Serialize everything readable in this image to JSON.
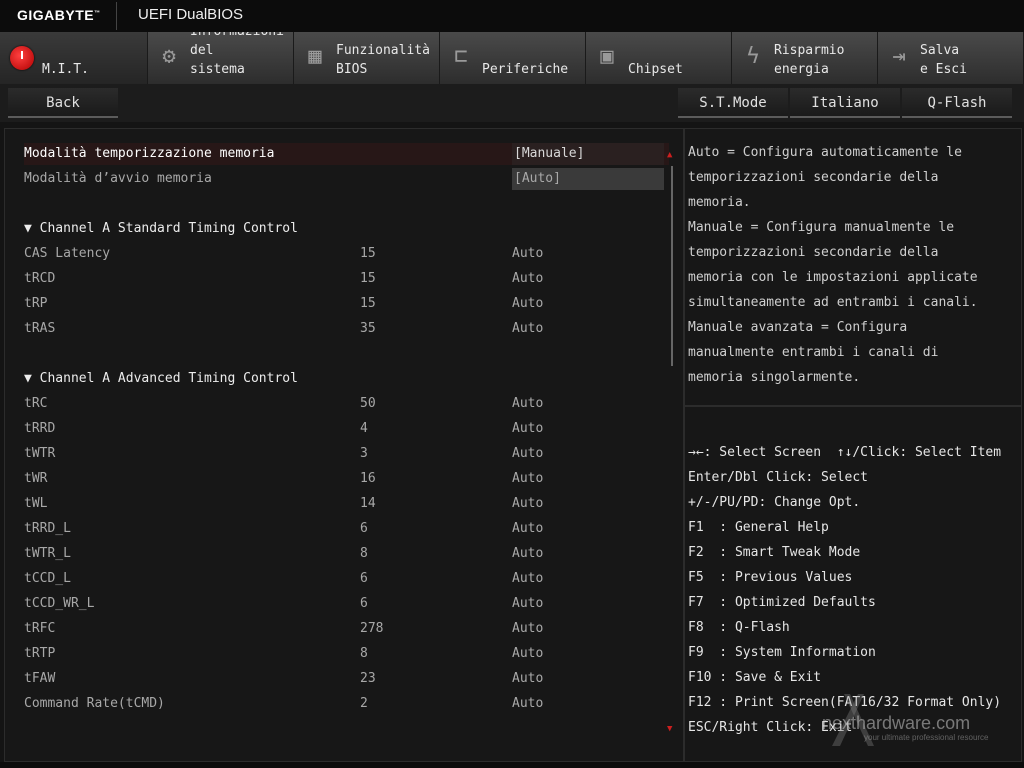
{
  "header": {
    "logo": "GIGABYTE",
    "logo_mark": "™",
    "title": "UEFI DualBIOS"
  },
  "tabs": [
    {
      "label": "M.I.T.",
      "icon": "power-dial-icon"
    },
    {
      "label": "Informazioni\ndel\nsistema",
      "icon": "gear-icon"
    },
    {
      "label": "Funzionalità\nBIOS",
      "icon": "chip-plus-icon"
    },
    {
      "label": "Periferiche",
      "icon": "plug-icon"
    },
    {
      "label": "Chipset",
      "icon": "chip-icon"
    },
    {
      "label": "Risparmio\nenergia",
      "icon": "lightning-icon"
    },
    {
      "label": "Salva\ne Esci",
      "icon": "exit-icon"
    }
  ],
  "buttons": {
    "back": "Back",
    "st_mode": "S.T.Mode",
    "language": "Italiano",
    "qflash": "Q-Flash"
  },
  "settings": {
    "timing_mode": {
      "label": "Modalità temporizzazione memoria",
      "value": "[Manuale]"
    },
    "boot_mode": {
      "label": "Modalità d’avvio memoria",
      "value": "[Auto]"
    }
  },
  "channel_a_standard": {
    "title": "▼ Channel A Standard Timing Control",
    "rows": [
      {
        "name": "CAS Latency",
        "value": "15",
        "mode": "Auto"
      },
      {
        "name": "tRCD",
        "value": "15",
        "mode": "Auto"
      },
      {
        "name": "tRP",
        "value": "15",
        "mode": "Auto"
      },
      {
        "name": "tRAS",
        "value": "35",
        "mode": "Auto"
      }
    ]
  },
  "channel_a_advanced": {
    "title": "▼ Channel A Advanced Timing Control",
    "rows": [
      {
        "name": "tRC",
        "value": "50",
        "mode": "Auto"
      },
      {
        "name": "tRRD",
        "value": "4",
        "mode": "Auto"
      },
      {
        "name": "tWTR",
        "value": "3",
        "mode": "Auto"
      },
      {
        "name": "tWR",
        "value": "16",
        "mode": "Auto"
      },
      {
        "name": "tWL",
        "value": "14",
        "mode": "Auto"
      },
      {
        "name": "tRRD_L",
        "value": "6",
        "mode": "Auto"
      },
      {
        "name": "tWTR_L",
        "value": "8",
        "mode": "Auto"
      },
      {
        "name": "tCCD_L",
        "value": "6",
        "mode": "Auto"
      },
      {
        "name": "tCCD_WR_L",
        "value": "6",
        "mode": "Auto"
      },
      {
        "name": "tRFC",
        "value": "278",
        "mode": "Auto"
      },
      {
        "name": "tRTP",
        "value": "8",
        "mode": "Auto"
      },
      {
        "name": "tFAW",
        "value": "23",
        "mode": "Auto"
      },
      {
        "name": "Command Rate(tCMD)",
        "value": "2",
        "mode": "Auto"
      }
    ]
  },
  "help_lines": [
    "Auto = Configura automaticamente le",
    "temporizzazioni secondarie della",
    "memoria.",
    "Manuale = Configura manualmente le",
    "temporizzazioni secondarie della",
    "memoria con le impostazioni applicate",
    "simultaneamente ad entrambi i canali.",
    "Manuale avanzata = Configura",
    "manualmente entrambi i canali di",
    "memoria singolarmente."
  ],
  "key_lines": [
    "→←: Select Screen  ↑↓/Click: Select Item",
    "Enter/Dbl Click: Select",
    "+/-/PU/PD: Change Opt.",
    "F1  : General Help",
    "F2  : Smart Tweak Mode",
    "F5  : Previous Values",
    "F7  : Optimized Defaults",
    "F8  : Q-Flash",
    "F9  : System Information",
    "F10 : Save & Exit",
    "F12 : Print Screen(FAT16/32 Format Only)",
    "ESC/Right Click: Exit"
  ],
  "watermark": {
    "text": "nexthardware.com",
    "tagline": "your ultimate professional resource"
  },
  "colors": {
    "accent": "#cc1f1f",
    "selected_row": "#271717",
    "background": "#141414"
  }
}
